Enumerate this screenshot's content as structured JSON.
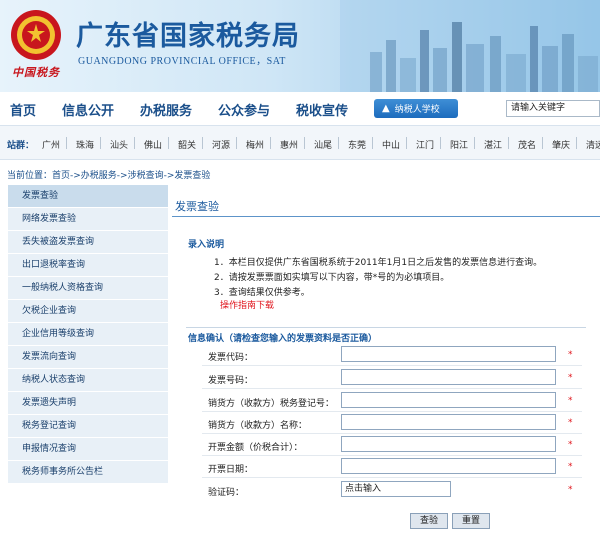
{
  "header": {
    "title": "广东省国家税务局",
    "subtitle": "GUANGDONG PROVINCIAL OFFICE，SAT",
    "emblem_text": "中国税务"
  },
  "nav": {
    "items": [
      "首页",
      "信息公开",
      "办税服务",
      "公众参与",
      "税收宣传"
    ],
    "school_label": "纳税人学校",
    "search_placeholder": "请输入关键字"
  },
  "sites": {
    "label": "站群：",
    "cities": [
      "广州",
      "珠海",
      "汕头",
      "佛山",
      "韶关",
      "河源",
      "梅州",
      "惠州",
      "汕尾",
      "东莞",
      "中山",
      "江门",
      "阳江",
      "湛江",
      "茂名",
      "肇庆",
      "清远"
    ]
  },
  "breadcrumb": "当前位置：首页->办税服务->涉税查询->发票查验",
  "menu": {
    "items": [
      "发票查验",
      "网络发票查验",
      "丢失被盗发票查询",
      "出口退税率查询",
      "一般纳税人资格查询",
      "欠税企业查询",
      "企业信用等级查询",
      "发票流向查询",
      "纳税人状态查询",
      "发票遗失声明",
      "税务登记查询",
      "申报情况查询",
      "税务师事务所公告栏"
    ]
  },
  "content": {
    "title": "发票查验",
    "notes_title": "录入说明",
    "notes": [
      "1．本栏目仅提供广东省国税系统于2011年1月1日之后发售的发票信息进行查询。",
      "2．请按发票票面如实填写以下内容，带*号的为必填项目。",
      "3．查询结果仅供参考。"
    ],
    "guide_link": "操作指南下载",
    "confirm_title": "信息确认（请检查您输入的发票资料是否正确）",
    "fields": [
      {
        "label": "发票代码：",
        "value": ""
      },
      {
        "label": "发票号码：",
        "value": ""
      },
      {
        "label": "销货方（收款方）税务登记号：",
        "value": ""
      },
      {
        "label": "销货方（收款方）名称：",
        "value": ""
      },
      {
        "label": "开票金额（价税合计）：",
        "value": ""
      },
      {
        "label": "开票日期：",
        "value": ""
      }
    ],
    "captcha_label": "验证码：",
    "captcha_value": "点击输入",
    "required_mark": "*",
    "submit_label": "查验",
    "reset_label": "重置"
  }
}
